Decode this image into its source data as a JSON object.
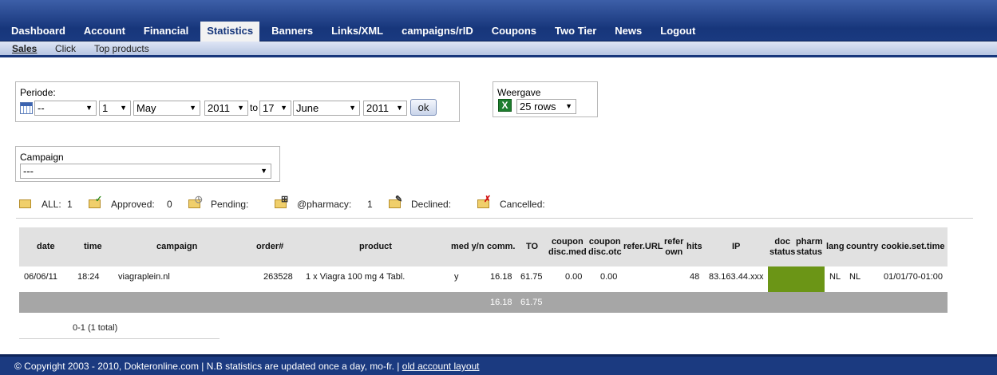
{
  "nav": {
    "tabs": [
      "Dashboard",
      "Account",
      "Financial",
      "Statistics",
      "Banners",
      "Links/XML",
      "campaigns/rID",
      "Coupons",
      "Two Tier",
      "News",
      "Logout"
    ],
    "active": "Statistics"
  },
  "subnav": {
    "items": [
      "Sales",
      "Click",
      "Top products"
    ],
    "active": "Sales"
  },
  "periode": {
    "label": "Periode:",
    "preset": "--",
    "from_day": "1",
    "from_month": "May",
    "from_year": "2011",
    "to_label": "to",
    "to_day": "17",
    "to_month": "June",
    "to_year": "2011",
    "ok_label": "ok"
  },
  "weergave": {
    "label": "Weergave",
    "rows": "25 rows",
    "excel_icon": "excel-icon"
  },
  "campaign": {
    "label": "Campaign",
    "value": "---"
  },
  "statuses": {
    "all_label": "ALL:",
    "all_count": "1",
    "approved_label": "Approved:",
    "approved_count": "0",
    "pending_label": "Pending:",
    "pharmacy_label": "@pharmacy:",
    "pharmacy_count": "1",
    "declined_label": "Declined:",
    "cancelled_label": "Cancelled:"
  },
  "table": {
    "headers": {
      "date": "date",
      "time": "time",
      "campaign": "campaign",
      "order": "order#",
      "product": "product",
      "med": "med y/n",
      "comm": "comm.",
      "to": "TO",
      "coupon_med_1": "coupon",
      "coupon_med_2": "disc.med",
      "coupon_otc_1": "coupon",
      "coupon_otc_2": "disc.otc",
      "refer_url": "refer.URL",
      "refer_own_1": "refer",
      "refer_own_2": "own",
      "hits": "hits",
      "ip": "IP",
      "doc_1": "doc",
      "doc_2": "status",
      "pharm_1": "pharm",
      "pharm_2": "status",
      "lang": "lang",
      "country": "country",
      "cookie": "cookie.set.time"
    },
    "rows": [
      {
        "date": "06/06/11",
        "time": "18:24",
        "campaign": "viagraplein.nl",
        "order": "263528",
        "product": "1 x Viagra 100 mg 4 Tabl.",
        "med": "y",
        "comm": "16.18",
        "to": "61.75",
        "coupon_med": "0.00",
        "coupon_otc": "0.00",
        "refer_url": "",
        "refer_own": "",
        "hits": "48",
        "ip": "83.163.44.xxx",
        "lang": "NL",
        "country": "NL",
        "cookie": "01/01/70-01:00"
      }
    ],
    "totals": {
      "comm": "16.18",
      "to": "61.75"
    },
    "status_color": "#6b9516"
  },
  "pager": "0-1 (1 total)",
  "footer": {
    "text": "© Copyright 2003 - 2010, Dokteronline.com | N.B statistics are updated once a day, mo-fr. | ",
    "link": "old account layout"
  }
}
